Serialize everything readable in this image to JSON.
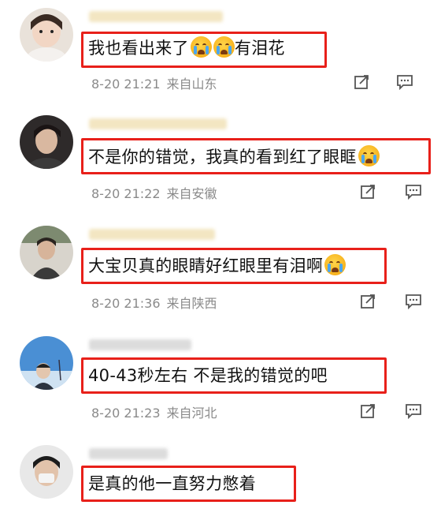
{
  "comments": [
    {
      "text": "我也看出来了",
      "text_after": "有泪花",
      "emojis_before_after": 2,
      "time": "8-20 21:21",
      "location": "来自山东",
      "name_color": "#f3e6c2",
      "avatar_icon": "child-avatar-icon"
    },
    {
      "text": "不是你的错觉，我真的看到红了眼眶",
      "text_after": "",
      "time": "8-20 21:22",
      "location": "来自安徽",
      "name_color": "#f3e6c2",
      "avatar_icon": "person-avatar-icon"
    },
    {
      "text": "大宝贝真的眼睛好红眼里有泪啊",
      "text_after": "",
      "time": "8-20 21:36",
      "location": "来自陕西",
      "name_color": "#f3e6c2",
      "avatar_icon": "person-avatar-icon"
    },
    {
      "text": "40-43秒左右 不是我的错觉的吧",
      "text_after": "",
      "time": "8-20 21:23",
      "location": "来自河北",
      "name_color": "#dcdcdc",
      "avatar_icon": "sky-avatar-icon"
    },
    {
      "text": "是真的他一直努力憋着",
      "text_after": "",
      "time": "",
      "location": "",
      "name_color": "#dcdcdc",
      "avatar_icon": "person-avatar-icon"
    }
  ],
  "colors": {
    "highlight_border": "#e8201a",
    "meta_text": "#8a8a8a",
    "body_text": "#111111"
  },
  "icons": {
    "share": "share-icon",
    "comment": "comment-icon"
  }
}
